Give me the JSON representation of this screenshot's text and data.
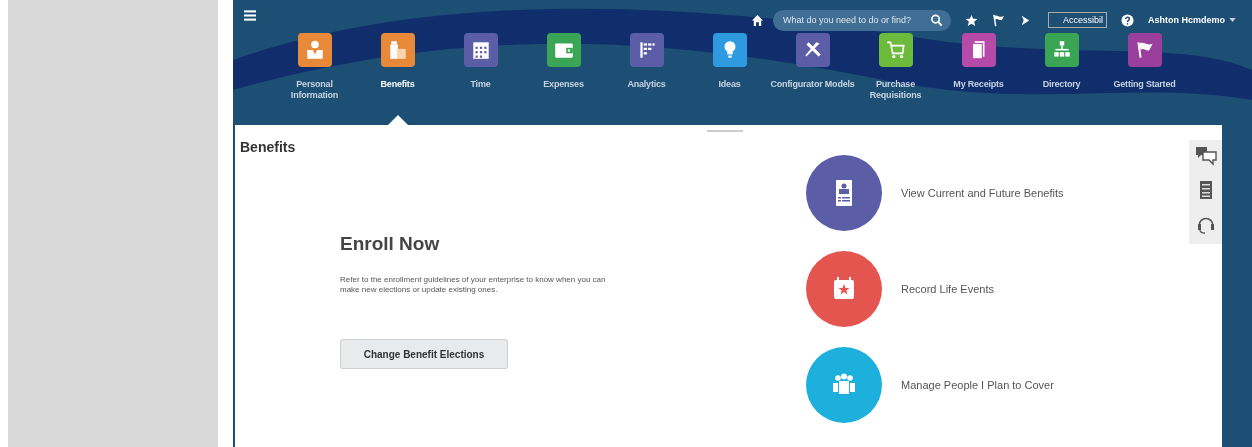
{
  "top_bar": {
    "search": {
      "placeholder": "What do you need to do or find?"
    },
    "accessibility_image": "Accessibil",
    "user_name": "Ashton Hcmdemo"
  },
  "apps": [
    {
      "label": "Personal\nInformation",
      "color": "#e8893a",
      "selected": false
    },
    {
      "label": "Benefits",
      "color": "#e8893a",
      "selected": true
    },
    {
      "label": "Time",
      "color": "#5b5ea6",
      "selected": false
    },
    {
      "label": "Expenses",
      "color": "#3aa655",
      "selected": false
    },
    {
      "label": "Analytics",
      "color": "#5b5ea6",
      "selected": false
    },
    {
      "label": "Ideas",
      "color": "#2e9be0",
      "selected": false
    },
    {
      "label": "Configurator Models",
      "color": "#5b5ea6",
      "selected": false
    },
    {
      "label": "Purchase\nRequisitions",
      "color": "#6cbb3c",
      "selected": false
    },
    {
      "label": "My Receipts",
      "color": "#b54aa8",
      "selected": false
    },
    {
      "label": "Directory",
      "color": "#3aa655",
      "selected": false
    },
    {
      "label": "Getting Started",
      "color": "#9b3f9e",
      "selected": false
    }
  ],
  "page": {
    "title": "Benefits",
    "enroll": {
      "heading": "Enroll Now",
      "text": "Refer to the enrollment guidelines of your enterprise to know when you can make new elections or update existing ones.",
      "button": "Change Benefit Elections"
    },
    "actions": [
      {
        "label": "View Current and Future Benefits",
        "color": "#5b5ea6"
      },
      {
        "label": "Record Life Events",
        "color": "#e5554f"
      },
      {
        "label": "Manage People I Plan to Cover",
        "color": "#1db0dd"
      }
    ]
  }
}
